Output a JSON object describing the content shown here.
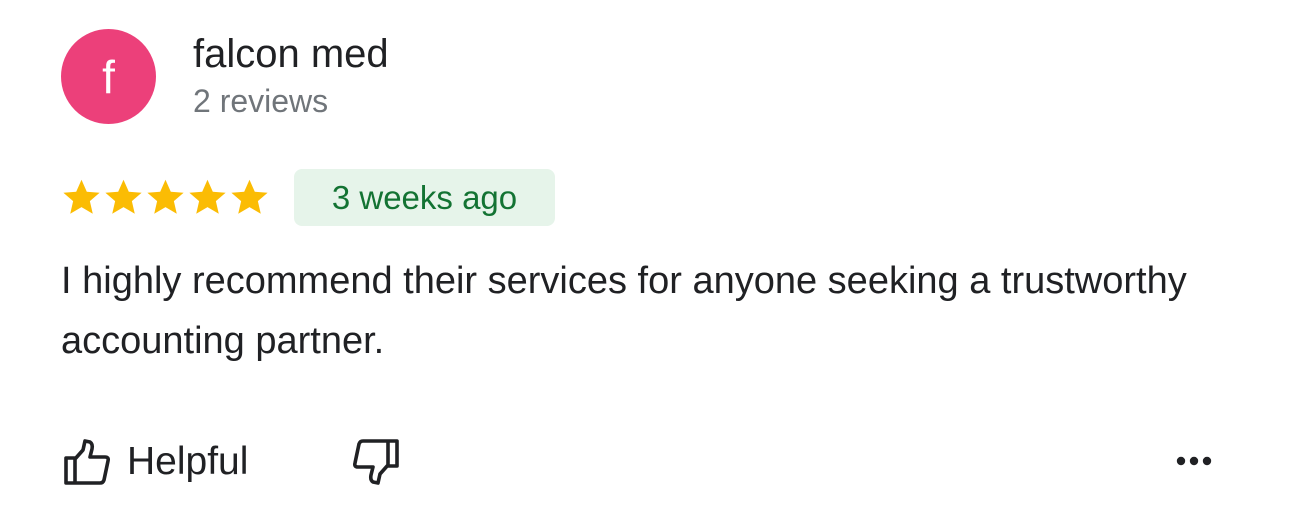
{
  "author": {
    "initial": "f",
    "name": "falcon med",
    "review_count": "2 reviews",
    "avatar_color": "#ec407a"
  },
  "rating": {
    "stars": 5,
    "max": 5,
    "star_color": "#fbbc04"
  },
  "time": {
    "label": "3 weeks ago",
    "badge_bg": "#e6f4ea",
    "badge_text_color": "#137333"
  },
  "review": {
    "text": "I highly recommend their services for anyone seeking a trustworthy accounting partner."
  },
  "actions": {
    "helpful_label": "Helpful",
    "helpful_icon": "thumb-up-icon",
    "unhelpful_icon": "thumb-down-icon",
    "more_icon": "more-horizontal-icon"
  }
}
